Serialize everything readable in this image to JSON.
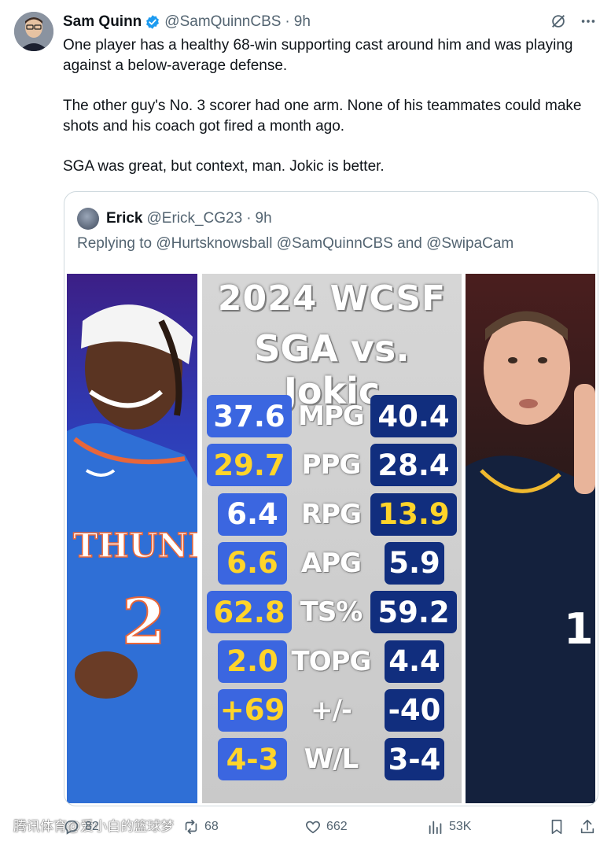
{
  "tweet": {
    "author_name": "Sam Quinn",
    "handle": "@SamQuinnCBS",
    "separator": "·",
    "time": "9h",
    "paragraphs": [
      "One player has a healthy 68-win supporting cast around him and was playing against a below-average defense.",
      "The other guy's No. 3 scorer had one arm. None of his teammates could make shots and his coach got fired a month ago.",
      "SGA was great, but context, man. Jokic is better."
    ]
  },
  "quote": {
    "author_name": "Erick",
    "handle": "@Erick_CG23",
    "separator": "·",
    "time": "9h",
    "reply_line": "Replying to @Hurtsknowsball @SamQuinnCBS and @SwipaCam"
  },
  "graphic": {
    "title_line1": "2024 WCSF",
    "title_line2": "SGA vs. Jokic",
    "jersey_left_text": "THUNDER",
    "jersey_left_number": "2",
    "rows": [
      {
        "label": "MPG",
        "left": "37.6",
        "right": "40.4",
        "left_gold": false,
        "right_gold": false
      },
      {
        "label": "PPG",
        "left": "29.7",
        "right": "28.4",
        "left_gold": true,
        "right_gold": false
      },
      {
        "label": "RPG",
        "left": "6.4",
        "right": "13.9",
        "left_gold": false,
        "right_gold": true
      },
      {
        "label": "APG",
        "left": "6.6",
        "right": "5.9",
        "left_gold": true,
        "right_gold": false
      },
      {
        "label": "TS%",
        "left": "62.8",
        "right": "59.2",
        "left_gold": true,
        "right_gold": false
      },
      {
        "label": "TOPG",
        "left": "2.0",
        "right": "4.4",
        "left_gold": true,
        "right_gold": false
      },
      {
        "label": "+/-",
        "left": "+69",
        "right": "-40",
        "left_gold": true,
        "right_gold": false
      },
      {
        "label": "W/L",
        "left": "4-3",
        "right": "3-4",
        "left_gold": true,
        "right_gold": false
      }
    ],
    "colors": {
      "sga_box": "#3b66e0",
      "jokic_box": "#112e7e",
      "leader_text": "#ffd42a"
    }
  },
  "actions": {
    "replies": "82",
    "reposts": "68",
    "likes": "662",
    "views": "53K"
  },
  "watermark": "腾讯体育@爱小白的篮球梦",
  "icons": [
    "verified-badge-icon",
    "grok-icon",
    "more-icon",
    "reply-icon",
    "repost-icon",
    "like-icon",
    "views-icon",
    "bookmark-icon",
    "share-icon"
  ]
}
